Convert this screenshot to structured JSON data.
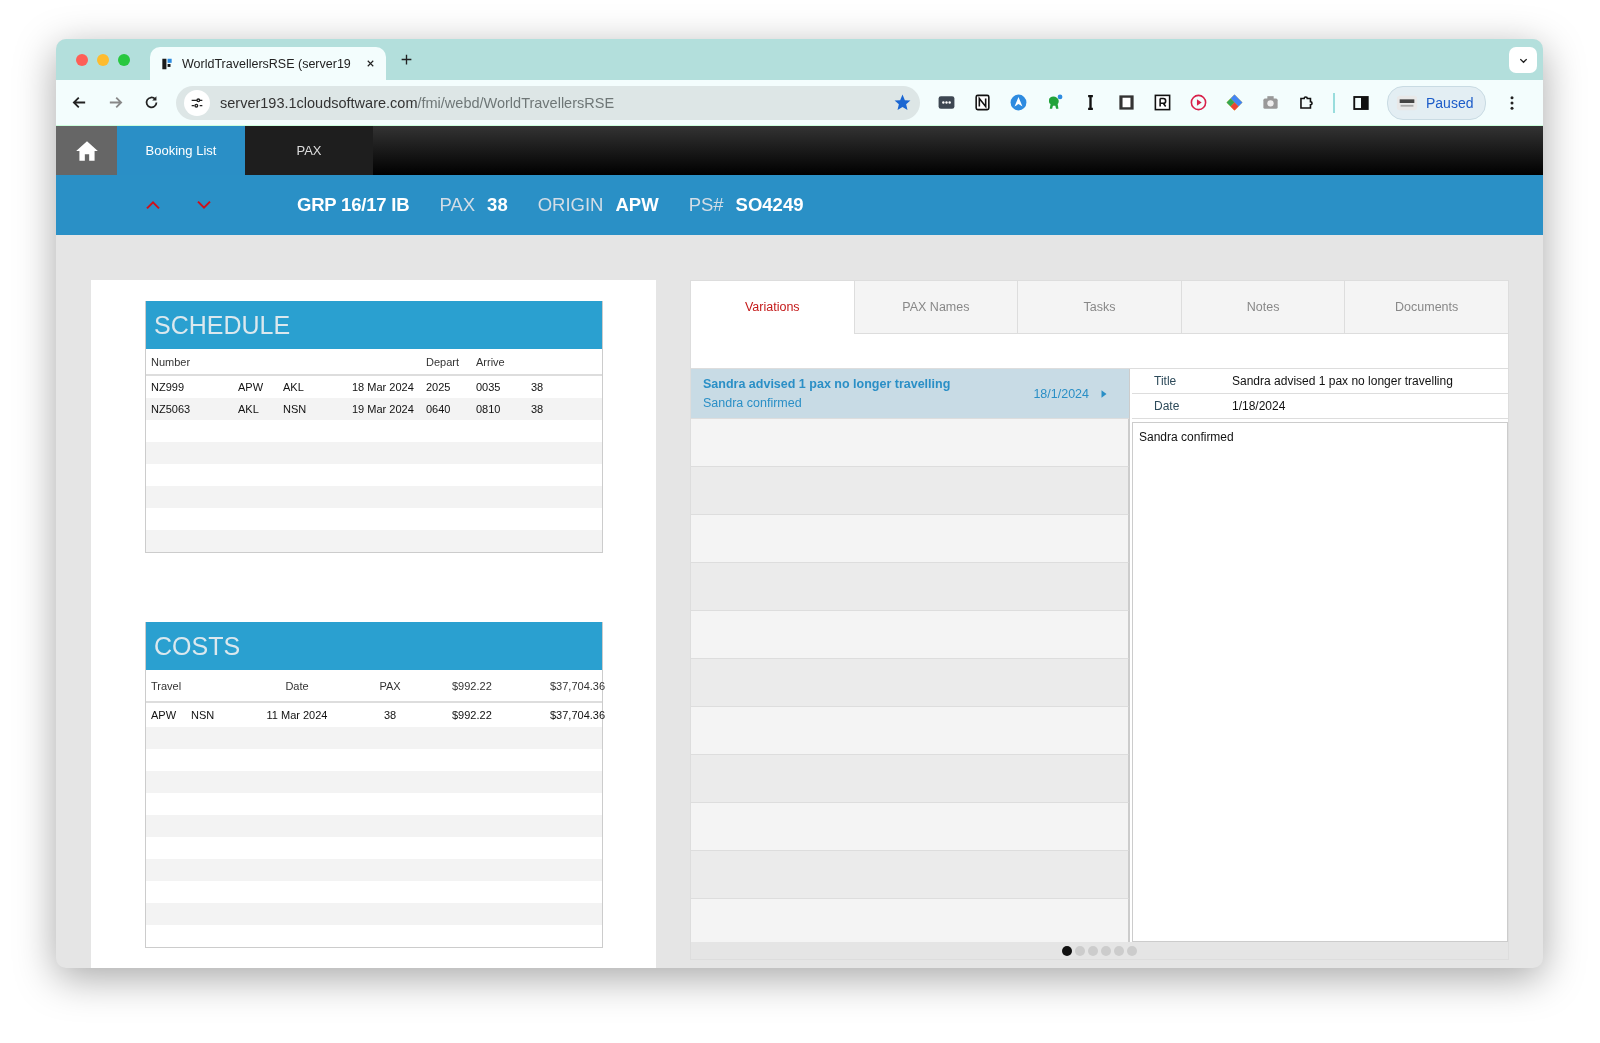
{
  "browser": {
    "tab_title": "WorldTravellersRSE (server19",
    "url_host": "server193.1cloudsoftware.com",
    "url_path": "/fmi/webd/WorldTravellersRSE",
    "profile_label": "Paused"
  },
  "nav_tabs": [
    {
      "label": "Booking List",
      "selected": true
    },
    {
      "label": "PAX",
      "selected": false
    }
  ],
  "header": {
    "group": "GRP 16/17 IB",
    "fields": [
      {
        "label": "PAX",
        "value": "38"
      },
      {
        "label": "ORIGIN",
        "value": "APW"
      },
      {
        "label": "PS#",
        "value": "SO4249"
      }
    ]
  },
  "schedule": {
    "title": "SCHEDULE",
    "columns": {
      "number": "Number",
      "depart": "Depart",
      "arrive": "Arrive"
    },
    "rows": [
      {
        "number": "NZ999",
        "column_2": "APW",
        "column_3": "AKL",
        "column_4": "18 Mar 2024",
        "depart": "2025",
        "arrive": "0035",
        "column_7": "38"
      },
      {
        "number": "NZ5063",
        "column_2": "AKL",
        "column_3": "NSN",
        "column_4": "19 Mar 2024",
        "depart": "0640",
        "arrive": "0810",
        "column_7": "38"
      }
    ]
  },
  "costs": {
    "title": "COSTS",
    "columns": {
      "travel": "Travel",
      "date": "Date",
      "pax": "PAX",
      "column_5": "$992.22",
      "column_6": "$37,704.36"
    },
    "rows": [
      {
        "column_1": "APW",
        "column_2": "NSN",
        "date": "11 Mar 2024",
        "pax": "38",
        "column_5": "$992.22",
        "column_6": "$37,704.36"
      }
    ]
  },
  "detail_tabs": [
    {
      "label": "Variations",
      "selected": true
    },
    {
      "label": "PAX Names",
      "selected": false
    },
    {
      "label": "Tasks",
      "selected": false
    },
    {
      "label": "Notes",
      "selected": false
    },
    {
      "label": "Documents",
      "selected": false
    }
  ],
  "variations": [
    {
      "title": "Sandra advised 1 pax no longer travelling",
      "subtitle": "Sandra confirmed",
      "date": "18/1/2024",
      "selected": true
    }
  ],
  "variation_detail": {
    "fields": [
      {
        "label": "Title",
        "value": "Sandra advised 1 pax no longer travelling"
      },
      {
        "label": "Date",
        "value": "1/18/2024"
      }
    ],
    "body": "Sandra confirmed"
  },
  "pager_dots": [
    {
      "selected": true
    },
    {
      "selected": false
    },
    {
      "selected": false
    },
    {
      "selected": false
    },
    {
      "selected": false
    },
    {
      "selected": false
    }
  ]
}
